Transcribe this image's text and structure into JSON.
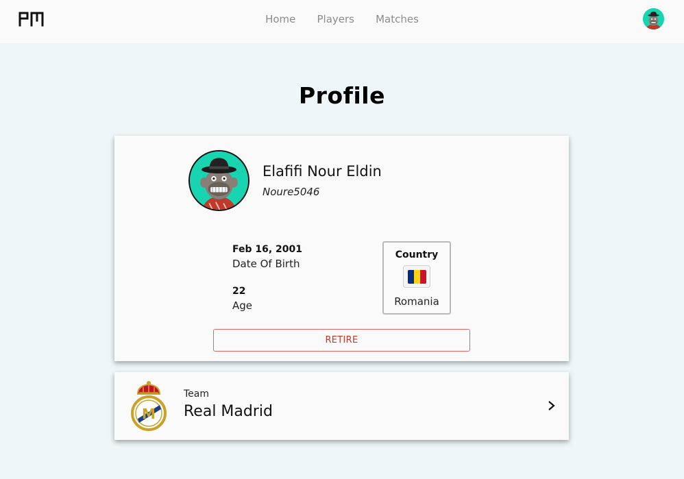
{
  "nav": {
    "logo_text": "PM",
    "links": [
      "Home",
      "Players",
      "Matches"
    ]
  },
  "page": {
    "title": "Profile"
  },
  "profile": {
    "name": "Elafifi Nour Eldin",
    "username": "Noure5046",
    "date_of_birth": {
      "value": "Feb 16, 2001",
      "label": "Date Of Birth"
    },
    "age": {
      "value": "22",
      "label": "Age"
    },
    "country": {
      "title": "Country",
      "name": "Romania",
      "flag_colors": [
        "#002b7f",
        "#fcd116",
        "#ce1126"
      ]
    },
    "retire_label": "RETIRE"
  },
  "team": {
    "label": "Team",
    "name": "Real Madrid"
  },
  "colors": {
    "accent_teal": "#19d4b0",
    "retire_red": "#c0392b",
    "page_bg": "#eef6f9"
  },
  "icons": [
    "logo-icon",
    "user-avatar-icon",
    "romania-flag-icon",
    "real-madrid-crest-icon",
    "chevron-right-icon"
  ]
}
